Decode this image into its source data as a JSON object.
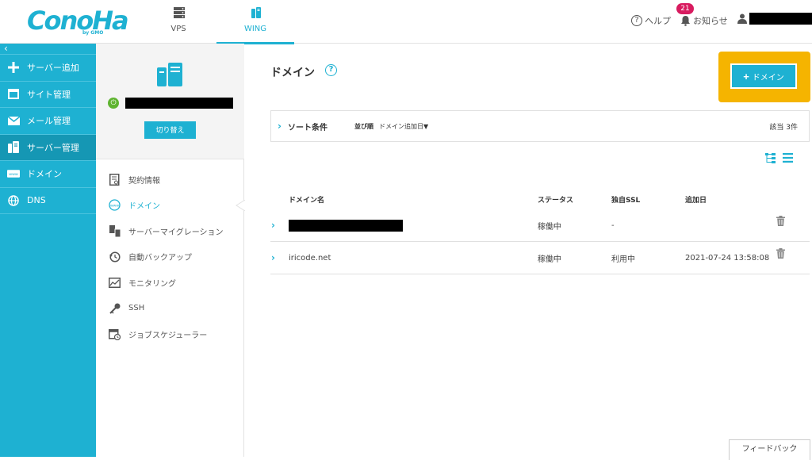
{
  "header": {
    "logo_text": "ConoHa",
    "logo_sub": "by GMO",
    "tabs": [
      {
        "label": "VPS",
        "icon": "server-stack-icon"
      },
      {
        "label": "WING",
        "icon": "wing-server-icon",
        "active": true
      }
    ],
    "help_label": "ヘルプ",
    "notice_label": "お知らせ",
    "notice_count": "21",
    "user_name": ""
  },
  "sidebar": {
    "collapse_glyph": "‹",
    "items": [
      {
        "label": "サーバー追加",
        "icon": "plus-icon"
      },
      {
        "label": "サイト管理",
        "icon": "window-icon"
      },
      {
        "label": "メール管理",
        "icon": "mail-icon"
      },
      {
        "label": "サーバー管理",
        "icon": "server-icon",
        "active": true
      },
      {
        "label": "ドメイン",
        "icon": "domain-icon"
      },
      {
        "label": "DNS",
        "icon": "globe-icon"
      }
    ]
  },
  "server_panel": {
    "server_name": "",
    "switch_label": "切り替え",
    "nav": [
      {
        "label": "契約情報",
        "icon": "contract-icon"
      },
      {
        "label": "ドメイン",
        "icon": "www-icon",
        "active": true
      },
      {
        "label": "サーバーマイグレーション",
        "icon": "migration-icon"
      },
      {
        "label": "自動バックアップ",
        "icon": "backup-icon"
      },
      {
        "label": "モニタリング",
        "icon": "monitoring-icon"
      },
      {
        "label": "SSH",
        "icon": "key-icon"
      },
      {
        "label": "ジョブスケジューラー",
        "icon": "scheduler-icon"
      }
    ]
  },
  "main": {
    "title": "ドメイン",
    "help_glyph": "?",
    "add_button_label": "ドメイン",
    "sort": {
      "label": "ソート条件",
      "order_label": "並び順",
      "order_value": "ドメイン追加日▼",
      "count": "該当 3件"
    },
    "table": {
      "headers": {
        "name": "ドメイン名",
        "status": "ステータス",
        "ssl": "独自SSL",
        "date": "追加日"
      },
      "rows": [
        {
          "name": "",
          "status": "稼働中",
          "ssl": "-",
          "date": ""
        },
        {
          "name": "iricode.net",
          "status": "稼働中",
          "ssl": "利用中",
          "date": "2021-07-24 13:58:08"
        }
      ]
    },
    "feedback_label": "フィードバック"
  },
  "colors": {
    "brand": "#1eb1d2",
    "sidebar_active": "#1597b4",
    "highlight": "#f5b400",
    "badge": "#d81b5f",
    "power_on": "#5fb431"
  }
}
